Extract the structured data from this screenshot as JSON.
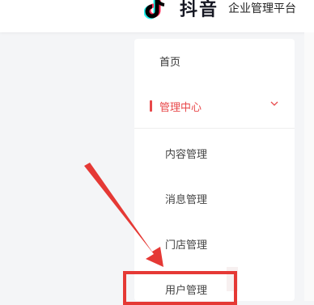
{
  "header": {
    "brand_name": "抖音",
    "brand_sub": "企业管理平台"
  },
  "sidebar": {
    "home": "首页",
    "group": {
      "label": "管理中心",
      "expanded": true
    },
    "items": [
      "内容管理",
      "消息管理",
      "门店管理",
      "用户管理"
    ]
  },
  "icons": {
    "logo": "douyin-logo-icon",
    "chevron": "chevron-down-icon"
  },
  "colors": {
    "accent": "#e8484a",
    "annotation": "#e53935"
  }
}
